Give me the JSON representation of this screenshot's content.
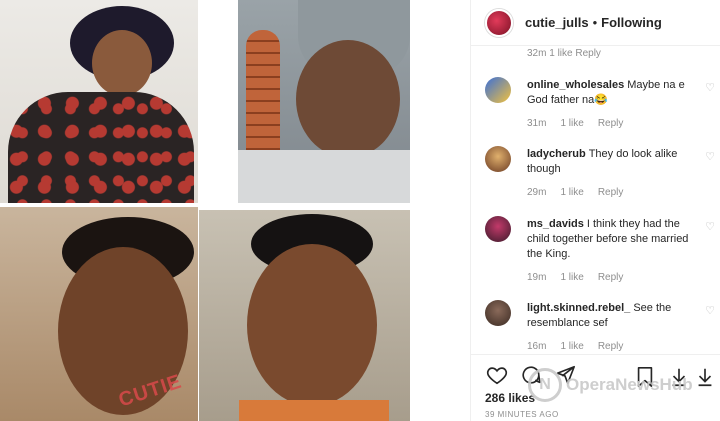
{
  "header": {
    "username": "cutie_julls",
    "separator": "•",
    "follow_label": "Following"
  },
  "ghost_meta": "32m   1 like   Reply",
  "comments": [
    {
      "user": "online_wholesales",
      "text": "Maybe na e God father na😂",
      "time": "31m",
      "likes": "1 like",
      "reply": "Reply"
    },
    {
      "user": "ladycherub",
      "text": "They do look alike though",
      "time": "29m",
      "likes": "1 like",
      "reply": "Reply"
    },
    {
      "user": "ms_davids",
      "text": "I think they had the child together before she married the King.",
      "time": "19m",
      "likes": "1 like",
      "reply": "Reply"
    },
    {
      "user": "light.skinned.rebel_",
      "text": "See the resemblance sef",
      "time": "16m",
      "likes": "1 like",
      "reply": "Reply"
    }
  ],
  "actions": {
    "likes": "286 likes",
    "timestamp": "39 MINUTES AGO"
  },
  "watermark": "OperaNewsHub",
  "overlay": "CUTIE",
  "icons": [
    "heart-icon",
    "comment-icon",
    "share-icon",
    "bookmark-icon",
    "download-icon",
    "comment-heart-icon"
  ],
  "colors": {
    "text": "#262626",
    "muted": "#8e8e8e",
    "border": "#efefef",
    "avatar_accent": "#c41f3e"
  }
}
